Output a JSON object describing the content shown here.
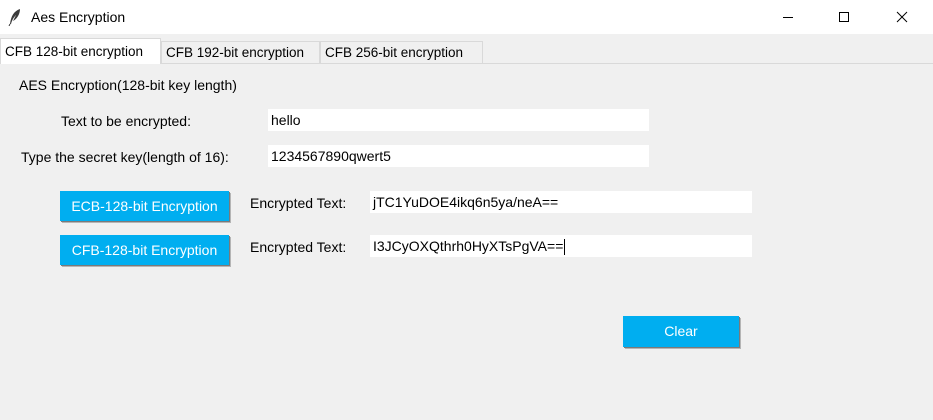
{
  "window": {
    "title": "Aes Encryption"
  },
  "tabs": [
    {
      "label": "CFB 128-bit encryption",
      "active": true
    },
    {
      "label": "CFB 192-bit encryption",
      "active": false
    },
    {
      "label": "CFB 256-bit encryption",
      "active": false
    }
  ],
  "panel": {
    "heading": "AES Encryption(128-bit key length)",
    "text_label": "Text to be encrypted:",
    "text_value": "hello",
    "key_label": "Type the secret key(length of 16):",
    "key_value": "1234567890qwert5",
    "ecb_button": "ECB-128-bit Encryption",
    "ecb_result_label": "Encrypted Text:",
    "ecb_result_value": "jTC1YuDOE4ikq6n5ya/neA==",
    "cfb_button": "CFB-128-bit Encryption",
    "cfb_result_label": "Encrypted Text:",
    "cfb_result_value": "I3JCyOXQthrh0HyXTsPgVA==",
    "clear_button": "Clear"
  },
  "colors": {
    "button_bg": "#00aef0",
    "button_text": "#ffffff",
    "window_bg": "#f0f0f0"
  },
  "icons": {
    "app": "feather-icon",
    "minimize": "minimize-icon",
    "maximize": "maximize-icon",
    "close": "close-icon"
  }
}
